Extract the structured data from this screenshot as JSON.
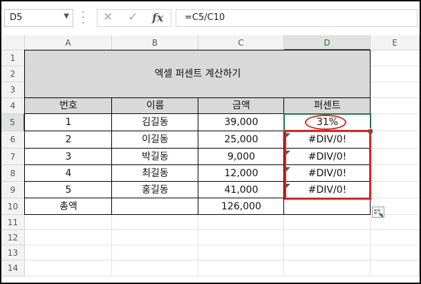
{
  "formula_bar": {
    "name_box": "D5",
    "formula": "=C5/C10"
  },
  "columns": [
    "A",
    "B",
    "C",
    "D",
    "E"
  ],
  "rows": [
    "1",
    "2",
    "3",
    "4",
    "5",
    "6",
    "7",
    "8",
    "9",
    "10",
    "11",
    "12",
    "13",
    "14"
  ],
  "sheet": {
    "title": "엑셀 퍼센트 계산하기",
    "headers": [
      "번호",
      "이름",
      "금액",
      "퍼센트"
    ],
    "data": [
      [
        "1",
        "김길동",
        "39,000",
        "31%"
      ],
      [
        "2",
        "이길동",
        "25,000",
        "#DIV/0!"
      ],
      [
        "3",
        "박길동",
        "9,000",
        "#DIV/0!"
      ],
      [
        "4",
        "최길동",
        "12,000",
        "#DIV/0!"
      ],
      [
        "5",
        "홍길동",
        "41,000",
        "#DIV/0!"
      ]
    ],
    "total": [
      "총액",
      "",
      "126,000",
      ""
    ]
  },
  "colors": {
    "accent": "#217346",
    "annotation": "#e02020",
    "header_fill": "#d9d9d9"
  }
}
